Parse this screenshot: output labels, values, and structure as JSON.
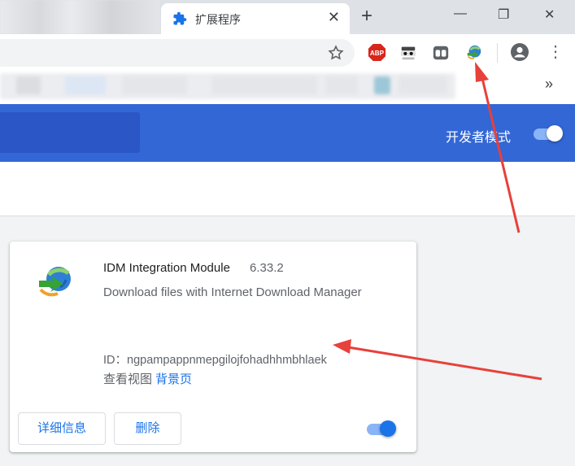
{
  "browser": {
    "tab": {
      "title": "扩展程序",
      "favicon": "puzzle-icon"
    },
    "new_tab_label": "+",
    "close_tab_label": "✕",
    "window_controls": {
      "minimize": "—",
      "maximize": "❐",
      "close": "✕"
    },
    "bookmarks_overflow": "»",
    "extensions": [
      "abp-icon",
      "spy-icon",
      "tabs-icon",
      "idm-icon"
    ],
    "abp_label": "ABP"
  },
  "header": {
    "developer_mode_label": "开发者模式",
    "developer_mode_on": true
  },
  "extension_card": {
    "name": "IDM Integration Module",
    "version": "6.33.2",
    "description": "Download files with Internet Download Manager",
    "id_label": "ID：",
    "id_value": "ngpampappnmepgilojfohadhhmbhlaek",
    "inspect_views_label": "查看视图",
    "background_page_link": "背景页",
    "details_button": "详细信息",
    "remove_button": "删除",
    "enabled": true
  },
  "colors": {
    "header_blue": "#3367d6",
    "accent_blue": "#1a73e8",
    "annotation_red": "#e8403a",
    "abp_red": "#d9261c"
  }
}
